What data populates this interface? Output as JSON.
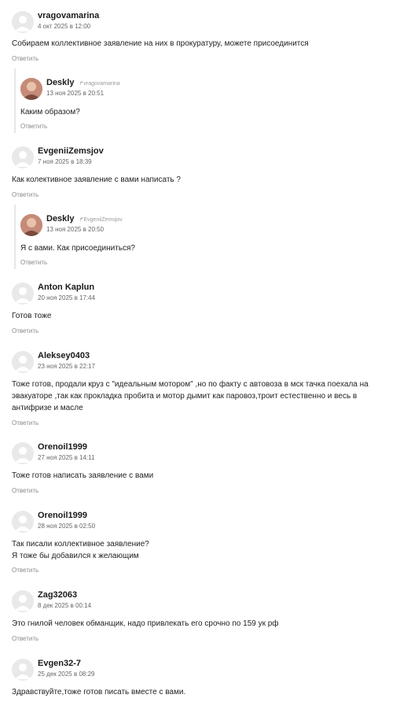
{
  "answer_label": "Ответить",
  "comments": [
    {
      "user": "vragovamarina",
      "date": "4 окт 2025 в 12:00",
      "lines": [
        "Собираем коллективное заявление на них в прокуратуру, можете присоединится"
      ]
    },
    {
      "user": "Deskly",
      "reply_to": "vragovamarina",
      "date": "13 ноя 2025 в 20:51",
      "lines": [
        "Каким образом?"
      ]
    },
    {
      "user": "EvgeniiZemsjov",
      "date": "7 ноя 2025 в 18:39",
      "lines": [
        "Как колективное заявление с вами написать ?"
      ]
    },
    {
      "user": "Deskly",
      "reply_to": "EvgeniiZemsjov",
      "date": "13 ноя 2025 в 20:50",
      "lines": [
        "Я с вами. Как присоединиться?"
      ]
    },
    {
      "user": "Anton Kaplun",
      "date": "20 ноя 2025 в 17:44",
      "lines": [
        "Готов тоже"
      ]
    },
    {
      "user": "Aleksey0403",
      "date": "23 ноя 2025 в 22:17",
      "lines": [
        "Тоже готов, продали круз с \"идеальным мотором\" ,но по факту с автовоза в мск тачка поехала на",
        "эвакуаторе ,так как прокладка пробита и мотор дымит как паровоз,троит естественно и весь в",
        "антифризе и масле"
      ]
    },
    {
      "user": "Orenoil1999",
      "date": "27 ноя 2025 в 14:11",
      "lines": [
        "Тоже готов написать заявление с вами"
      ]
    },
    {
      "user": "Orenoil1999",
      "date": "28 ноя 2025 в 02:50",
      "lines": [
        "Так писали коллективное заявление?",
        "Я тоже бы добавился к желающим"
      ]
    },
    {
      "user": "Zag32063",
      "date": "8 дек 2025 в 00:14",
      "lines": [
        "Это гнилой человек обманщик, надо привлекать его срочно по 159 ук рф"
      ]
    },
    {
      "user": "Evgen32-7",
      "date": "25 дек 2025 в 08:29",
      "lines": [
        "Здравствуйте,тоже готов писать вместе с вами."
      ]
    }
  ]
}
